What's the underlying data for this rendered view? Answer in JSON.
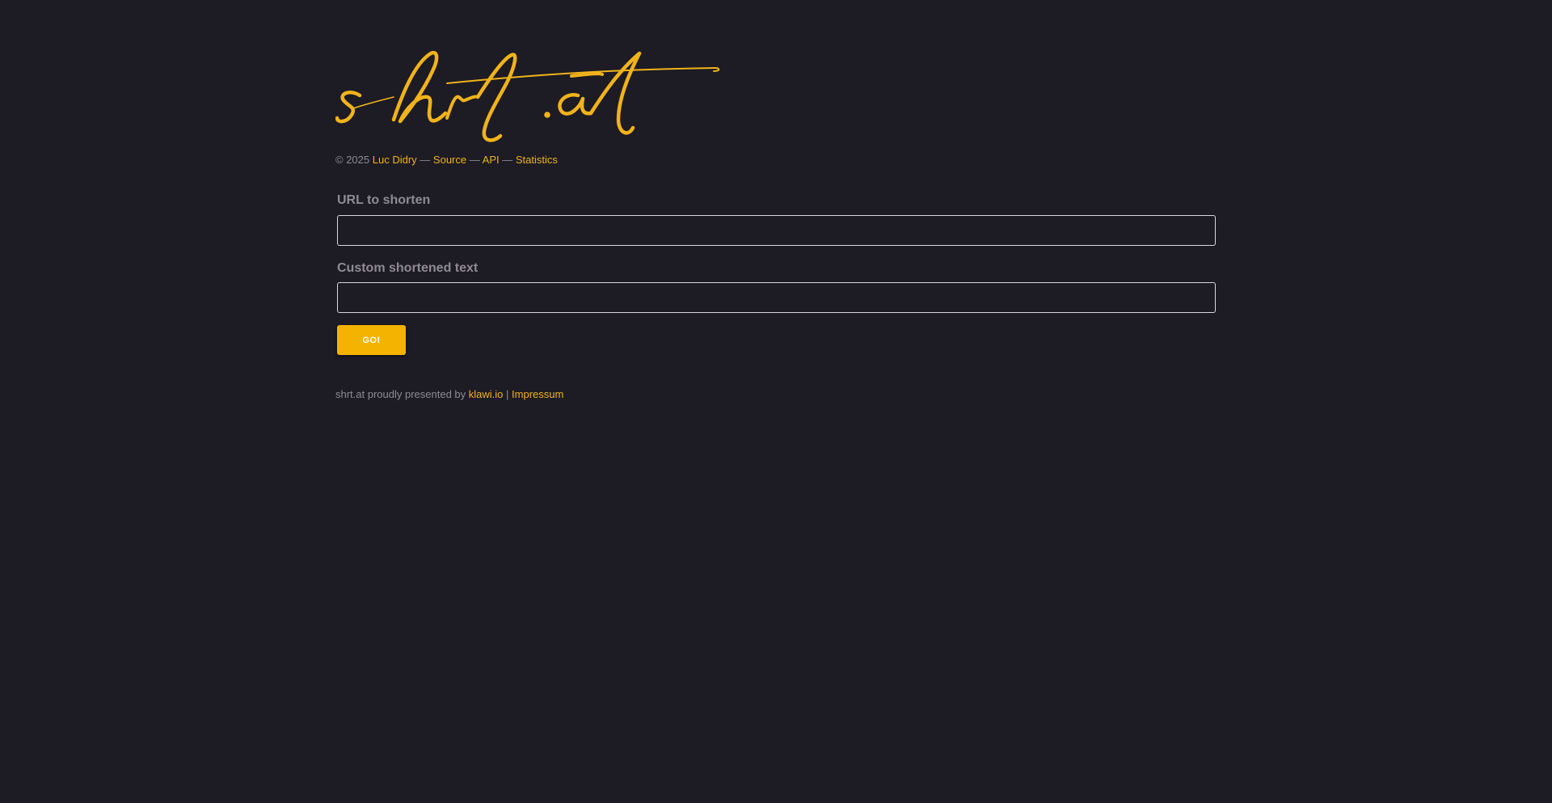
{
  "brand": {
    "logo_text": "shrt.at",
    "accent_color": "#f0b31a",
    "background_color": "#1d1b24"
  },
  "credits": {
    "copyright": "© 2025",
    "author": "Luc Didry",
    "separator": "—",
    "source": "Source",
    "api": "API",
    "statistics": "Statistics"
  },
  "form": {
    "url_label": "URL to shorten",
    "url_value": "",
    "custom_label": "Custom shortened text",
    "custom_value": "",
    "submit_label": "GO!"
  },
  "footer": {
    "prefix": "shrt.at proudly presented by",
    "presenter": "klawi.io",
    "divider": "|",
    "impressum": "Impressum"
  }
}
